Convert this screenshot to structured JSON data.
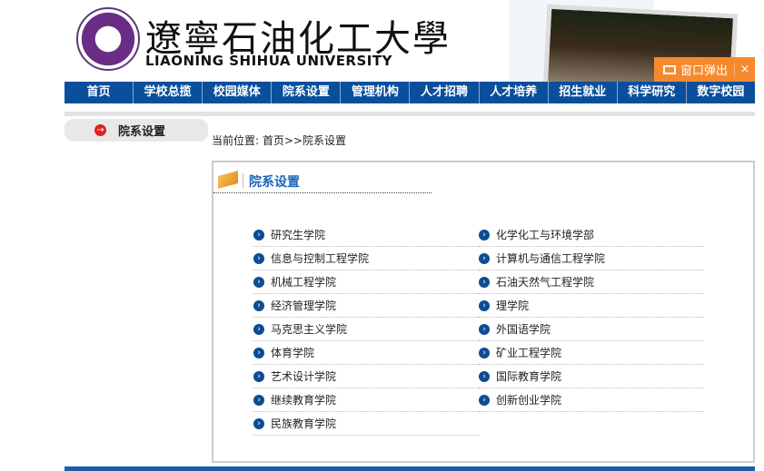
{
  "header": {
    "cn_name": "遼寧石油化工大學",
    "en_name": "LIAONING SHIHUA UNIVERSITY",
    "popup_label": "窗口弹出",
    "popup_close": "×"
  },
  "nav": [
    "首页",
    "学校总揽",
    "校园媒体",
    "院系设置",
    "管理机构",
    "人才招聘",
    "人才培养",
    "招生就业",
    "科学研究",
    "数字校园"
  ],
  "sidebar": {
    "title": "院系设置"
  },
  "breadcrumb": "当前位置:  首页>>院系设置",
  "box": {
    "title": "院系设置"
  },
  "colleges": [
    "研究生学院",
    "化学化工与环境学部",
    "信息与控制工程学院",
    "计算机与通信工程学院",
    "机械工程学院",
    "石油天然气工程学院",
    "经济管理学院",
    "理学院",
    "马克思主义学院",
    "外国语学院",
    "体育学院",
    "矿业工程学院",
    "艺术设计学院",
    "国际教育学院",
    "继续教育学院",
    "创新创业学院",
    "民族教育学院"
  ]
}
